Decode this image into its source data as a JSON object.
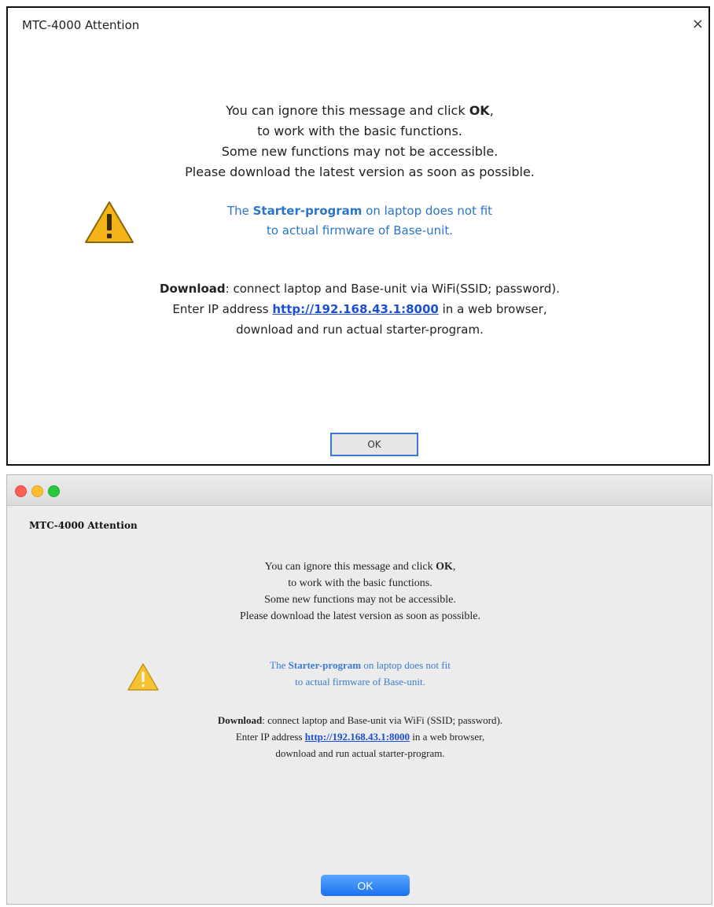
{
  "windows_dialog": {
    "title": "MTC-4000 Attention",
    "close_glyph": "×",
    "intro": {
      "l1_pre": "You can ignore this message and click ",
      "l1_bold": "OK",
      "l1_post": ",",
      "l2": "to work with the basic functions.",
      "l3": "Some new functions may not be accessible.",
      "l4": "Please download the latest version as soon as possible."
    },
    "warning": {
      "icon": "warning-icon",
      "l1_pre": "The ",
      "l1_bold": "Starter-program",
      "l1_post": " on laptop does not fit",
      "l2": "to actual firmware of Base-unit."
    },
    "download": {
      "l1_bold": "Download",
      "l1_post": ": connect laptop and Base-unit via WiFi(SSID; password).",
      "l2_pre": "Enter IP address ",
      "link": "http://192.168.43.1:8000",
      "l2_post": " in a web browser,",
      "l3": "download and run actual starter-program."
    },
    "ok_label": "OK"
  },
  "mac_dialog": {
    "title": "MTC-4000 Attention",
    "intro": {
      "l1_pre": "You can ignore this message and click ",
      "l1_bold": "OK",
      "l1_post": ",",
      "l2": "to work with the basic functions.",
      "l3": "Some new functions may not be accessible.",
      "l4": "Please download the latest version as soon as possible."
    },
    "warning": {
      "icon": "warning-icon",
      "l1_pre": "The ",
      "l1_bold": "Starter-program",
      "l1_post": " on laptop does not fit",
      "l2": "to actual firmware of Base-unit."
    },
    "download": {
      "l1_bold": "Download",
      "l1_post": ": connect laptop and Base-unit via WiFi (SSID; password).",
      "l2_pre": "Enter IP address ",
      "link": "http://192.168.43.1:8000",
      "l2_post": " in a web browser,",
      "l3": "download and run actual starter-program."
    },
    "ok_label": "OK"
  },
  "colors": {
    "link": "#1a4fd6",
    "warning_blue": "#2a74c9",
    "warning_yellow": "#f2b418",
    "mac_button": "#1a72f0"
  }
}
